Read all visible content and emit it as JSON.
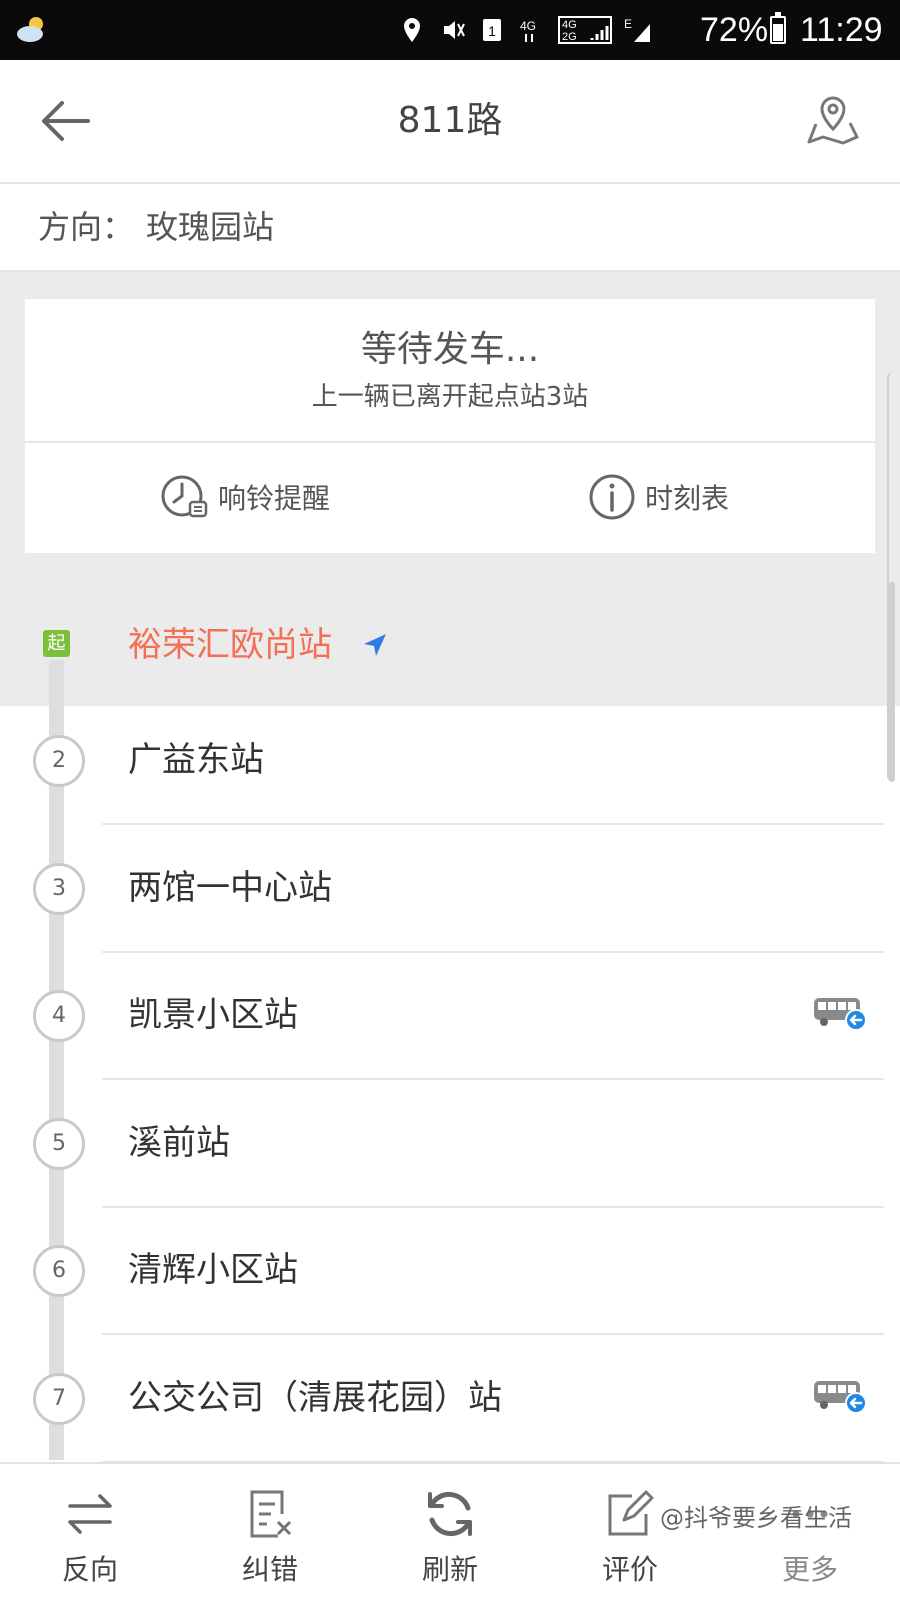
{
  "status_bar": {
    "battery": "72%",
    "time": "11:29",
    "network_labels": [
      "4G",
      "4G",
      "2G",
      "E"
    ],
    "sim": "1"
  },
  "header": {
    "title": "811路"
  },
  "direction": {
    "label": "方向：",
    "value": "玫瑰园站"
  },
  "status_card": {
    "waiting": "等待发车...",
    "previous_bus": "上一辆已离开起点站3站",
    "ring_reminder": "响铃提醒",
    "timetable": "时刻表"
  },
  "start_station": {
    "badge": "起",
    "name": "裕荣汇欧尚站"
  },
  "stations": [
    {
      "num": "2",
      "name": "广益东站",
      "bus": false
    },
    {
      "num": "3",
      "name": "两馆一中心站",
      "bus": false
    },
    {
      "num": "4",
      "name": "凯景小区站",
      "bus": true
    },
    {
      "num": "5",
      "name": "溪前站",
      "bus": false
    },
    {
      "num": "6",
      "name": "清辉小区站",
      "bus": false
    },
    {
      "num": "7",
      "name": "公交公司（清展花园）站",
      "bus": true
    }
  ],
  "bottom_nav": [
    {
      "label": "反向",
      "icon": "swap-icon"
    },
    {
      "label": "纠错",
      "icon": "correction-icon"
    },
    {
      "label": "刷新",
      "icon": "refresh-icon"
    },
    {
      "label": "评价",
      "icon": "edit-icon"
    },
    {
      "label": "更多",
      "icon": "more-icon"
    }
  ],
  "watermark": "@抖爷要乡看生活",
  "colors": {
    "accent_start": "#f36f55",
    "start_badge": "#7cbf3a",
    "location_arrow": "#2f7de1",
    "bus_badge": "#1e88e5"
  }
}
